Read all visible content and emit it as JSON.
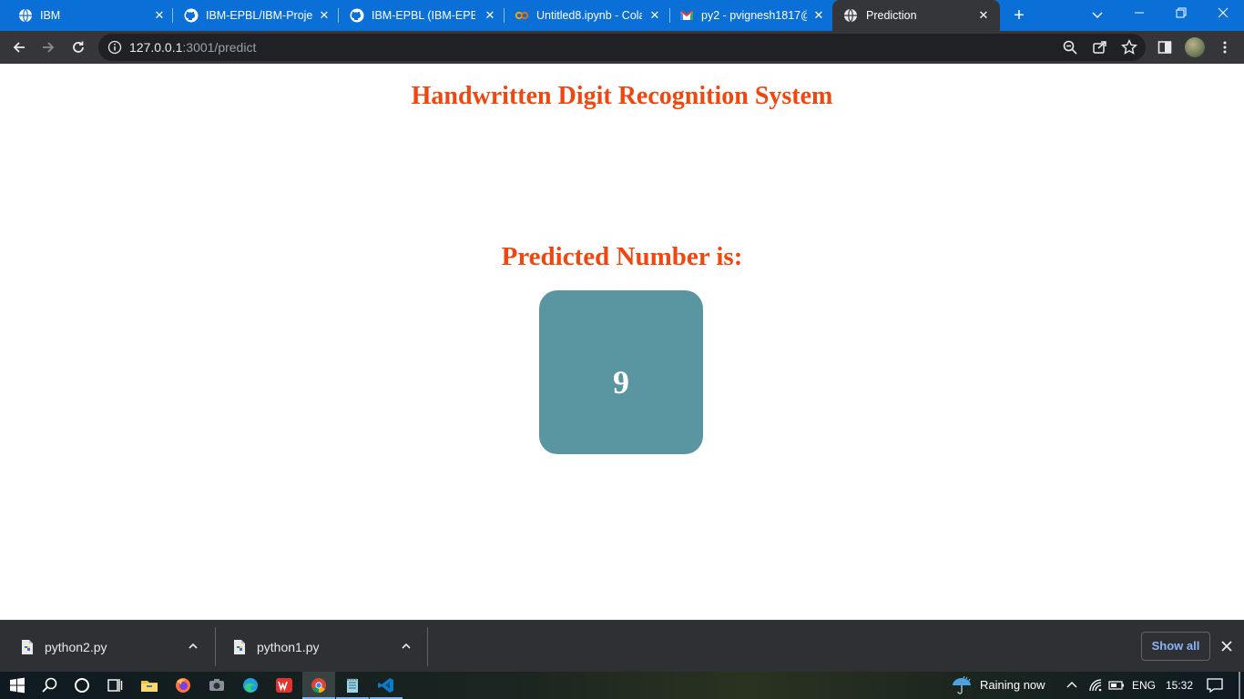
{
  "browser": {
    "tabs": [
      {
        "title": "IBM",
        "favicon": "globe-icon",
        "active": false
      },
      {
        "title": "IBM-EPBL/IBM-Project",
        "favicon": "github-icon",
        "active": false
      },
      {
        "title": "IBM-EPBL (IBM-EPBL)",
        "favicon": "github-icon",
        "active": false
      },
      {
        "title": "Untitled8.ipynb - Cola",
        "favicon": "colab-icon",
        "active": false
      },
      {
        "title": "py2 - pvignesh1817@",
        "favicon": "gmail-icon",
        "active": false
      },
      {
        "title": "Prediction",
        "favicon": "globe-icon",
        "active": true
      }
    ],
    "url_host": "127.0.0.1",
    "url_rest": ":3001/predict"
  },
  "page": {
    "title": "Handwritten Digit Recognition System",
    "prediction_heading": "Predicted Number is:",
    "prediction_value": "9"
  },
  "downloads": {
    "items": [
      {
        "name": "python2.py"
      },
      {
        "name": "python1.py"
      }
    ],
    "show_all_label": "Show all"
  },
  "taskbar": {
    "weather": "Raining now",
    "language": "ENG",
    "time": "15:32"
  },
  "colors": {
    "tabstrip": "#0b6fd8",
    "toolbar": "#35363a",
    "heading": "#f0460f",
    "prediction_box": "#5996a2"
  }
}
